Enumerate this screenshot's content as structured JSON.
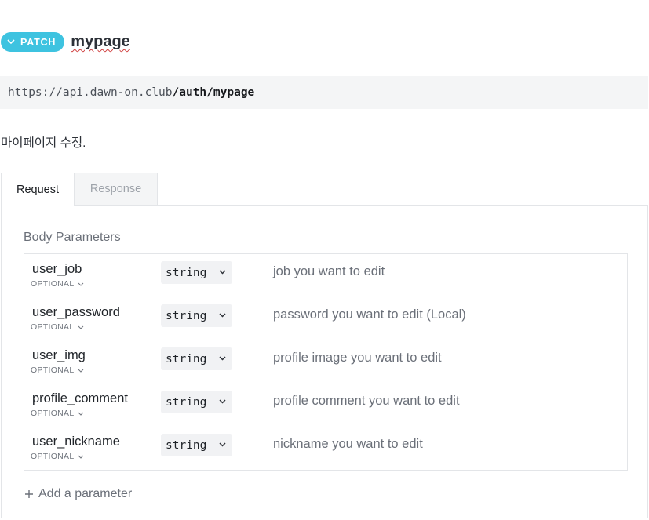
{
  "endpoint": {
    "method": "PATCH",
    "title": "mypage",
    "url_base": "https://api.dawn-on.club",
    "url_path": "/auth/mypage",
    "description": "마이페이지 수정."
  },
  "tabs": [
    {
      "label": "Request",
      "active": true
    },
    {
      "label": "Response",
      "active": false
    }
  ],
  "body": {
    "section_title": "Body Parameters",
    "add_label": "Add a parameter",
    "params": [
      {
        "name": "user_job",
        "optional": "OPTIONAL",
        "type": "string",
        "description": "job you want to edit"
      },
      {
        "name": "user_password",
        "optional": "OPTIONAL",
        "type": "string",
        "description": "password you want to edit (Local)"
      },
      {
        "name": "user_img",
        "optional": "OPTIONAL",
        "type": "string",
        "description": "profile image you want to edit"
      },
      {
        "name": "profile_comment",
        "optional": "OPTIONAL",
        "type": "string",
        "description": "profile comment you want to edit"
      },
      {
        "name": "user_nickname",
        "optional": "OPTIONAL",
        "type": "string",
        "description": "nickname you want to edit"
      }
    ]
  },
  "colors": {
    "method_badge": "#3ec3e0",
    "url_background": "#f4f5f6",
    "muted_text": "#6b7079"
  },
  "icons": {
    "badge": "chevron-down-icon",
    "optional": "chevron-down-icon",
    "type_select": "chevron-down-icon",
    "add": "plus-icon"
  }
}
